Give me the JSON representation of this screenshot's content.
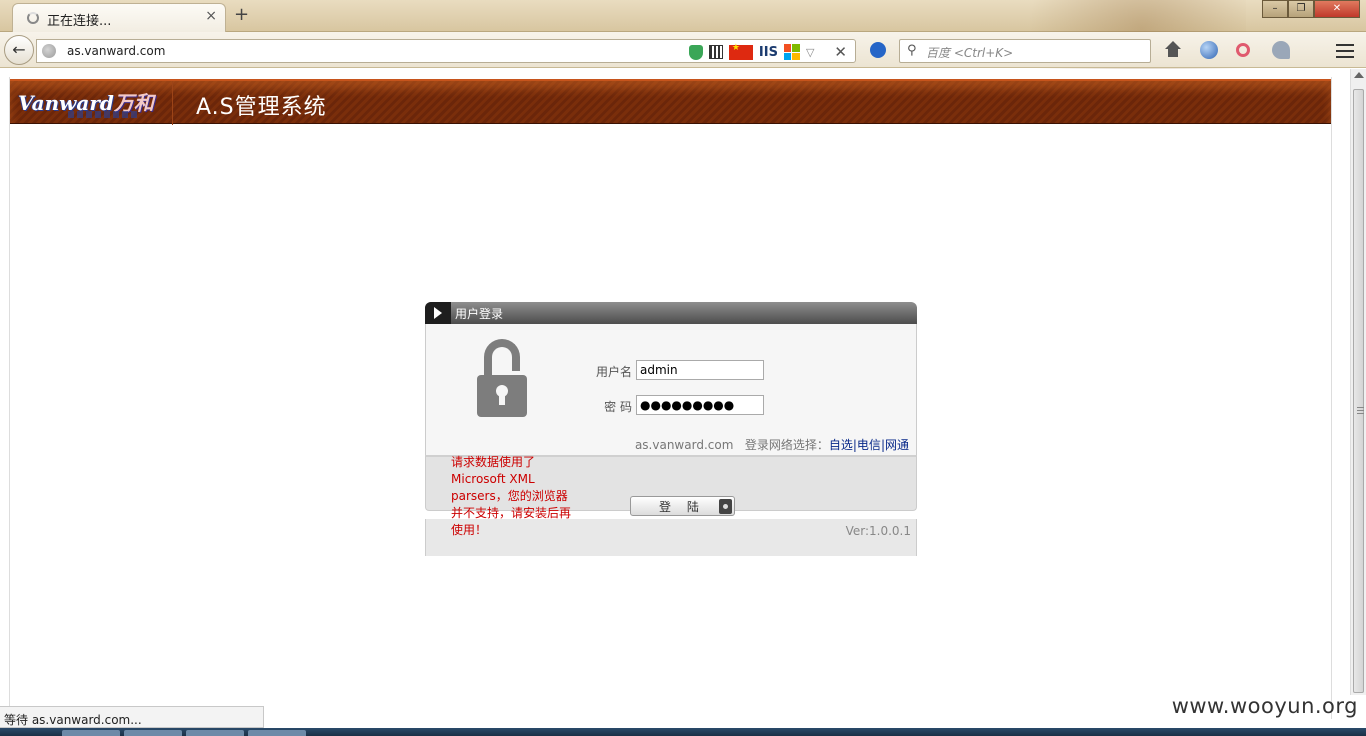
{
  "browser": {
    "tab_title": "正在连接...",
    "tab_close": "×",
    "new_tab": "+",
    "url": "as.vanward.com",
    "url_badge": "IIS",
    "search_placeholder": "百度 <Ctrl+K>",
    "window_buttons": {
      "minimize": "–",
      "maximize": "❐",
      "close": "✕"
    },
    "status_text": "等待 as.vanward.com..."
  },
  "header": {
    "logo_en": "Vanward",
    "logo_cn": "万和",
    "app_title": "A.S管理系统"
  },
  "login": {
    "title": "用户登录",
    "username_label": "用户名",
    "username_value": "admin",
    "password_label": "密 码",
    "password_value": "●●●●●●●●●",
    "domain": "as.vanward.com",
    "network_label": "登录网络选择：",
    "network_options": [
      "自选",
      "电信",
      "网通"
    ],
    "network_separator": "|",
    "submit_label": "登 陆",
    "error_message": "请求数据使用了Microsoft XML parsers，您的浏览器并不支持，请安装后再使用！",
    "version": "Ver:1.0.0.1"
  },
  "watermark": "www.wooyun.org"
}
